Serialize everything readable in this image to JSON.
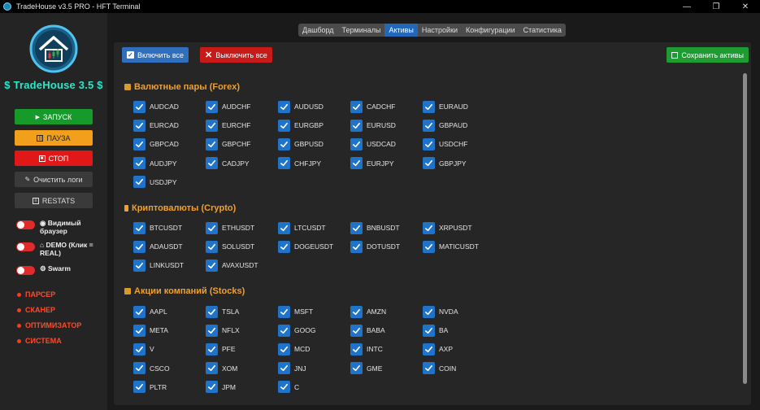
{
  "window": {
    "title": "TradeHouse v3.5 PRO - HFT Terminal",
    "controls": [
      "—",
      "❐",
      "✕"
    ]
  },
  "sidebar": {
    "brand": "TradeHouse 3.5",
    "brand_mark": "$",
    "buttons": {
      "start": "ЗАПУСК",
      "pause": "ПАУЗА",
      "stop": "СТОП",
      "clear_logs": "Очистить логи",
      "restats": "RESTATS"
    },
    "toggles": [
      {
        "label": "Видимый браузер",
        "on": false
      },
      {
        "label": "DEMO (Клик = REAL)",
        "on": false
      },
      {
        "label": "Swarm",
        "on": false
      }
    ],
    "nav": [
      "ПАРСЕР",
      "СКАНЕР",
      "ОПТИМИЗАТОР",
      "СИСТЕМА"
    ]
  },
  "tabs": [
    {
      "label": "Дашборд",
      "active": false
    },
    {
      "label": "Терминалы",
      "active": false
    },
    {
      "label": "Активы",
      "active": true
    },
    {
      "label": "Настройки",
      "active": false
    },
    {
      "label": "Конфигурации",
      "active": false
    },
    {
      "label": "Статистика",
      "active": false
    }
  ],
  "actions": {
    "enable_all": "Включить все",
    "disable_all": "Выключить все",
    "save": "Сохранить активы"
  },
  "sections": [
    {
      "title": "Валютные пары (Forex)",
      "items": [
        "AUDCAD",
        "AUDCHF",
        "AUDUSD",
        "CADCHF",
        "EURAUD",
        "EURCAD",
        "EURCHF",
        "EURGBP",
        "EURUSD",
        "GBPAUD",
        "GBPCAD",
        "GBPCHF",
        "GBPUSD",
        "USDCAD",
        "USDCHF",
        "AUDJPY",
        "CADJPY",
        "CHFJPY",
        "EURJPY",
        "GBPJPY",
        "USDJPY"
      ]
    },
    {
      "title": "Криптовалюты (Crypto)",
      "items": [
        "BTCUSDT",
        "ETHUSDT",
        "LTCUSDT",
        "BNBUSDT",
        "XRPUSDT",
        "ADAUSDT",
        "SOLUSDT",
        "DOGEUSDT",
        "DOTUSDT",
        "MATICUSDT",
        "LINKUSDT",
        "AVAXUSDT"
      ]
    },
    {
      "title": "Акции компаний (Stocks)",
      "items": [
        "AAPL",
        "TSLA",
        "MSFT",
        "AMZN",
        "NVDA",
        "META",
        "NFLX",
        "GOOG",
        "BABA",
        "BA",
        "V",
        "PFE",
        "MCD",
        "INTC",
        "AXP",
        "CSCO",
        "XOM",
        "JNJ",
        "GME",
        "COIN",
        "PLTR",
        "JPM",
        "C"
      ]
    }
  ],
  "colors": {
    "accent_blue": "#2467b8",
    "checkbox": "#1f73c9",
    "section_title": "#f0a030",
    "danger": "#e01818",
    "success": "#169a2a",
    "warning": "#f2a01c"
  }
}
